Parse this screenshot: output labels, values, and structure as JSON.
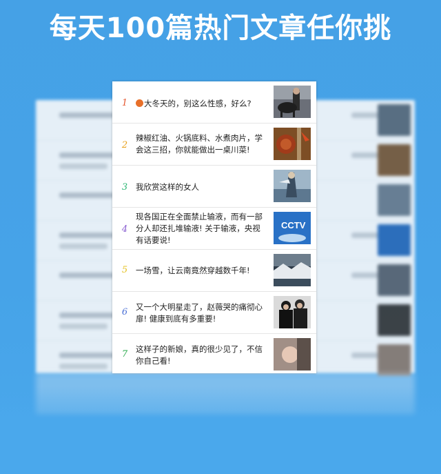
{
  "headline": "每天100篇热门文章任你挑",
  "articles": [
    {
      "rank": "1",
      "title": "大冬天的，别这么性感，好么?",
      "has_dot": true,
      "rank_color": "#e5572f",
      "thumb_icon": "dog-photo-icon"
    },
    {
      "rank": "2",
      "title": "辣椒红油、火锅底料、水煮肉片，学会这三招，你就能做出一桌川菜!",
      "rank_color": "#e8a019",
      "thumb_icon": "chili-photo-icon"
    },
    {
      "rank": "3",
      "title": "我欣赏这样的女人",
      "rank_color": "#2bb673",
      "thumb_icon": "painting-photo-icon"
    },
    {
      "rank": "4",
      "title": "现各国正在全面禁止输液，而有一部分人却还扎堆输液! 关于输液，央视有话要说!",
      "rank_color": "#8a5fd1",
      "thumb_icon": "cctv-logo-icon",
      "thumb_text": "CCTV"
    },
    {
      "rank": "5",
      "title": "一场雪，让云南竟然穿越数千年!",
      "rank_color": "#e4c020",
      "thumb_icon": "snow-landscape-icon"
    },
    {
      "rank": "6",
      "title": "又一个大明星走了，赵薇哭的痛彻心扉! 健康到底有多重要!",
      "rank_color": "#4a6fd6",
      "thumb_icon": "people-photo-icon"
    },
    {
      "rank": "7",
      "title": "这样子的新娘，真的很少见了，不信你自己看!",
      "rank_color": "#27a84a",
      "thumb_icon": "bride-photo-icon"
    }
  ],
  "colors": {
    "background": "#46a3e8",
    "card": "#ffffff",
    "text": "#222222"
  }
}
